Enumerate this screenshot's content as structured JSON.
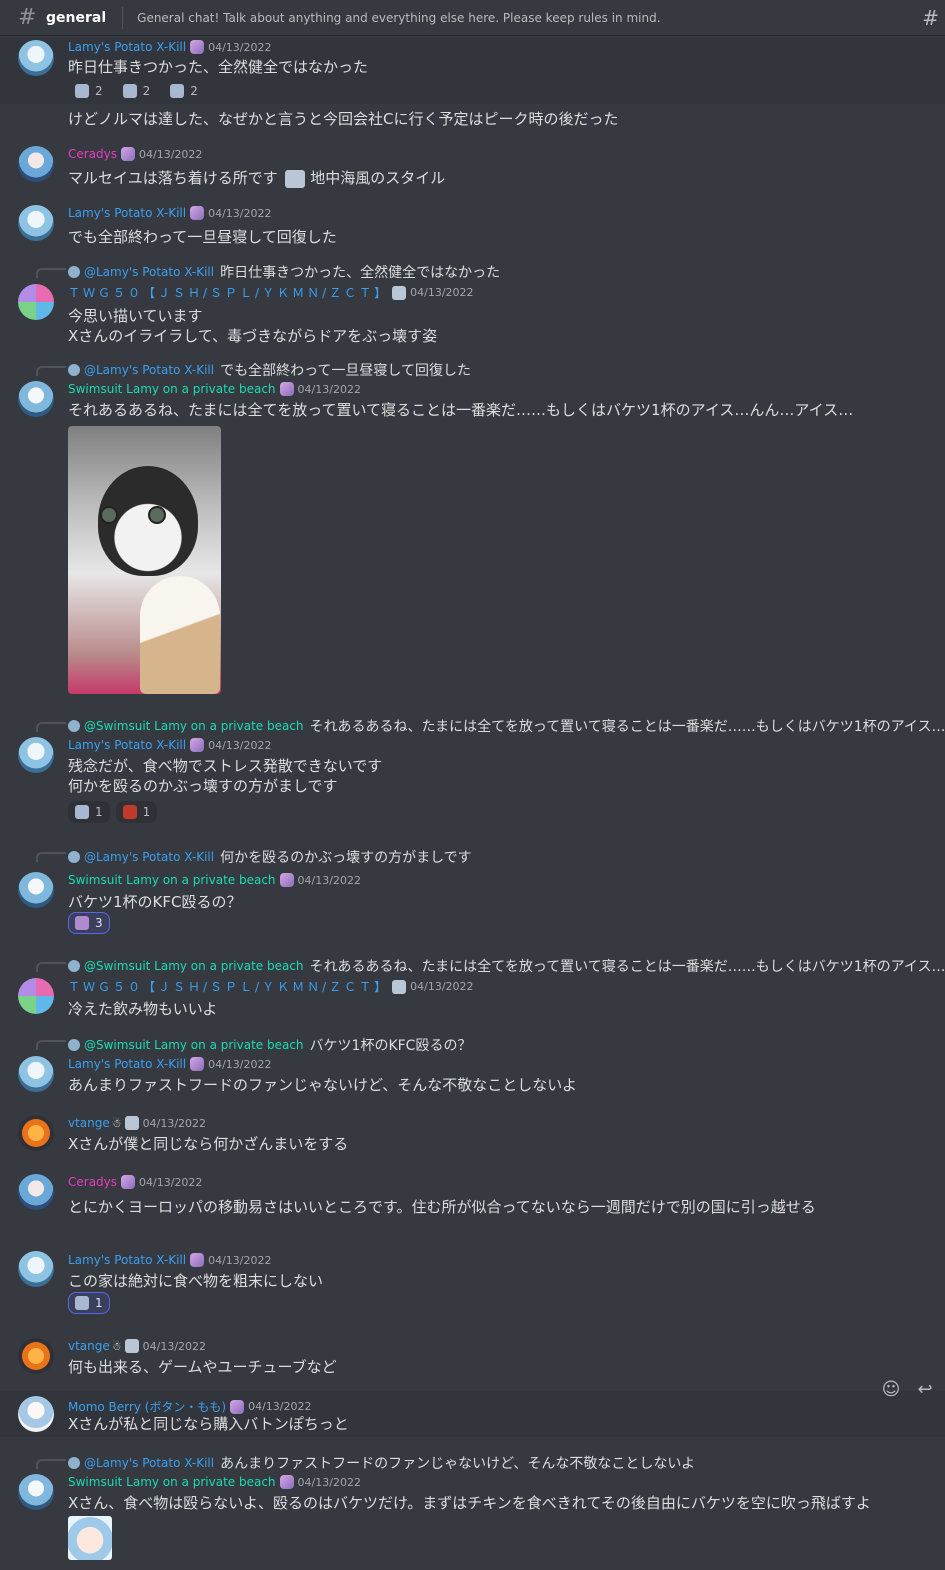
{
  "channel": {
    "name": "general",
    "topic": "General chat! Talk about anything and everything else here. Please keep rules in mind."
  },
  "messages": [
    {
      "id": "m1",
      "author": "Lamy's Potato X-Kill",
      "ts": "04/13/2022",
      "lines": [
        "昨日仕事きつかった、全然健全ではなかった"
      ],
      "reactions": [
        {
          "count": "2"
        },
        {
          "count": "2"
        },
        {
          "count": "2"
        }
      ]
    },
    {
      "id": "m1b",
      "lines": [
        "けどノルマは達した、なぜかと言うと今回会社Cに行く予定はピーク時の後だった"
      ]
    },
    {
      "id": "m2",
      "author": "Ceradys",
      "ts": "04/13/2022",
      "lines": [
        "マルセイユは落ち着ける所です",
        "地中海風のスタイル"
      ]
    },
    {
      "id": "m3",
      "author": "Lamy's Potato X-Kill",
      "ts": "04/13/2022",
      "lines": [
        "でも全部終わって一旦昼寝して回復した"
      ]
    },
    {
      "id": "m4",
      "reply_to": "@Lamy's Potato X-Kill",
      "reply_text": "昨日仕事きつかった、全然健全ではなかった",
      "author": "ＴＷＧ５０【ＪＳＨ/ＳＰＬ/ＹＫＭＮ/ＺＣＴ】",
      "ts": "04/13/2022",
      "lines": [
        "今思い描いています",
        "Xさんのイライラして、毒づきながらドアをぶっ壊す姿"
      ]
    },
    {
      "id": "m5",
      "reply_to": "@Lamy's Potato X-Kill",
      "reply_text": "でも全部終わって一旦昼寝して回復した",
      "author": "Swimsuit Lamy on a private beach",
      "ts": "04/13/2022",
      "lines": [
        "それあるあるね、たまには全てを放って置いて寝ることは一番楽だ……もしくはバケツ1杯のアイス…んん…アイス…"
      ]
    },
    {
      "id": "m6",
      "reply_to": "@Swimsuit Lamy on a private beach",
      "reply_text": "それあるあるね、たまには全てを放って置いて寝ることは一番楽だ……もしくはバケツ1杯のアイス…",
      "author": "Lamy's Potato X-Kill",
      "ts": "04/13/2022",
      "lines": [
        "残念だが、食べ物でストレス発散できないです",
        "何かを殴るのかぶっ壊すの方がましです"
      ],
      "reactions": [
        {
          "count": "1"
        },
        {
          "count": "1"
        }
      ]
    },
    {
      "id": "m7",
      "reply_to": "@Lamy's Potato X-Kill",
      "reply_text": "何かを殴るのかぶっ壊すの方がましです",
      "author": "Swimsuit Lamy on a private beach",
      "ts": "04/13/2022",
      "lines": [
        "バケツ1杯のKFC殴るの？"
      ],
      "reactions": [
        {
          "count": "3"
        }
      ]
    },
    {
      "id": "m8",
      "reply_to": "@Swimsuit Lamy on a private beach",
      "reply_text": "それあるあるね、たまには全てを放って置いて寝ることは一番楽だ……もしくはバケツ1杯のアイス…",
      "author": "ＴＷＧ５０【ＪＳＨ/ＳＰＬ/ＹＫＭＮ/ＺＣＴ】",
      "ts": "04/13/2022",
      "lines": [
        "冷えた飲み物もいいよ"
      ]
    },
    {
      "id": "m9",
      "reply_to": "@Swimsuit Lamy on a private beach",
      "reply_text": "バケツ1杯のKFC殴るの？",
      "author": "Lamy's Potato X-Kill",
      "ts": "04/13/2022",
      "lines": [
        "あんまりファストフードのファンじゃないけど、そんな不敬なことしないよ"
      ]
    },
    {
      "id": "m10",
      "author": "vtange",
      "ts": "04/13/2022",
      "lines": [
        "Xさんが僕と同じなら何かざんまいをする"
      ]
    },
    {
      "id": "m11",
      "author": "Ceradys",
      "ts": "04/13/2022",
      "lines": [
        "とにかくヨーロッパの移動易さはいいところです。住む所が似合ってないなら一週間だけで別の国に引っ越せる"
      ]
    },
    {
      "id": "m12",
      "author": "Lamy's Potato X-Kill",
      "ts": "04/13/2022",
      "lines": [
        "この家は絶対に食べ物を粗末にしない"
      ],
      "reactions": [
        {
          "count": "1"
        }
      ]
    },
    {
      "id": "m13",
      "author": "vtange",
      "ts": "04/13/2022",
      "lines": [
        "何も出来る、ゲームやユーチューブなど"
      ]
    },
    {
      "id": "m14",
      "author": "Momo Berry (ボタン・もも)",
      "ts": "04/13/2022",
      "lines": [
        "Xさんが私と同じなら購入バトンぽちっと"
      ]
    },
    {
      "id": "m15",
      "reply_to": "@Lamy's Potato X-Kill",
      "reply_text": "あんまりファストフードのファンじゃないけど、そんな不敬なことしないよ",
      "author": "Swimsuit Lamy on a private beach",
      "ts": "04/13/2022",
      "lines": [
        "Xさん、食べ物は殴らないよ、殴るのはバケツだけ。まずはチキンを食べきれてその後自由にバケツを空に吹っ飛ばすよ"
      ]
    }
  ],
  "icons": {
    "channel": "hash-icon",
    "threads": "threads-icon",
    "add_reaction": "add-reaction-icon",
    "reply": "reply-icon"
  },
  "colors": {
    "background": "#36393f",
    "lamy": "#3aa0f0",
    "ceradys": "#e83cc2",
    "swimsuit": "#1bdcb4"
  }
}
